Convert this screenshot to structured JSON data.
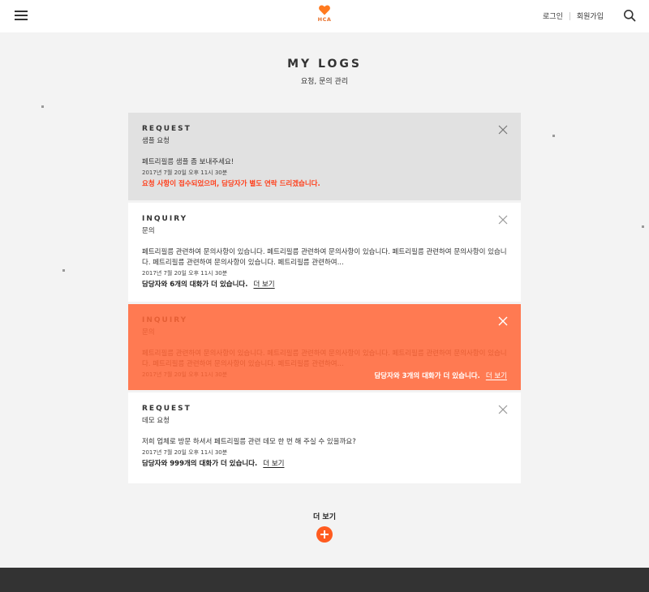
{
  "header": {
    "logo_text": "HCA",
    "login": "로그인",
    "signup": "회원가입",
    "icons": [
      "hamburger-menu-icon",
      "heart-logo-icon",
      "search-icon"
    ],
    "brand_color": "#e8702a"
  },
  "page": {
    "title": "MY LOGS",
    "subtitle": "요청, 문의 관리"
  },
  "cards": [
    {
      "tag": "REQUEST",
      "category": "샘플 요청",
      "message": "페트리필름 샘플 좀 보내주세요!",
      "date": "2017년 7월 20일 오후 11시 30분",
      "status": "요청 사항이 접수되었으며, 담당자가 별도 연락 드리겠습니다.",
      "status_color": "#ff3e1a"
    },
    {
      "tag": "INQUIRY",
      "category": "문의",
      "message": "페트리필름 관련하여 문의사항이 있습니다. 페트리필름 관련하여 문의사항이 있습니다. 페트리필름 관련하여 문의사항이 있습니다. 페트리필름 관련하여 문의사항이 있습니다. 페트리필름 관련하여...",
      "date": "2017년 7월 20일 오후 11시 30분",
      "status": "담당자와 6개의 대화가 더 있습니다.",
      "more": "더 보기"
    },
    {
      "tag": "INQUIRY",
      "category": "문의",
      "message": "페트리필름 관련하여 문의사항이 있습니다. 페트리필름 관련하여 문의사항이 있습니다. 페트리필름 관련하여 문의사항이 있습니다. 페트리필름 관련하여 문의사항이 있습니다. 페트리필름 관련하여...",
      "date": "2017년 7월 20일 오후 11시 30분",
      "status": "담당자와 3개의 대화가 더 있습니다.",
      "more": "더 보기",
      "highlight_color": "#ff7a52"
    },
    {
      "tag": "REQUEST",
      "category": "데모 요청",
      "message": "저희 업체로 방문 하셔서 페트리필름 관련 데모 한 번 해 주실 수 있을까요?",
      "date": "2017년 7월 20일 오후 11시 30분",
      "status": "담당자와 999개의 대화가 더 있습니다.",
      "more": "더 보기"
    }
  ],
  "load_more": {
    "label": "더 보기",
    "button_color": "#ff5b1f"
  }
}
